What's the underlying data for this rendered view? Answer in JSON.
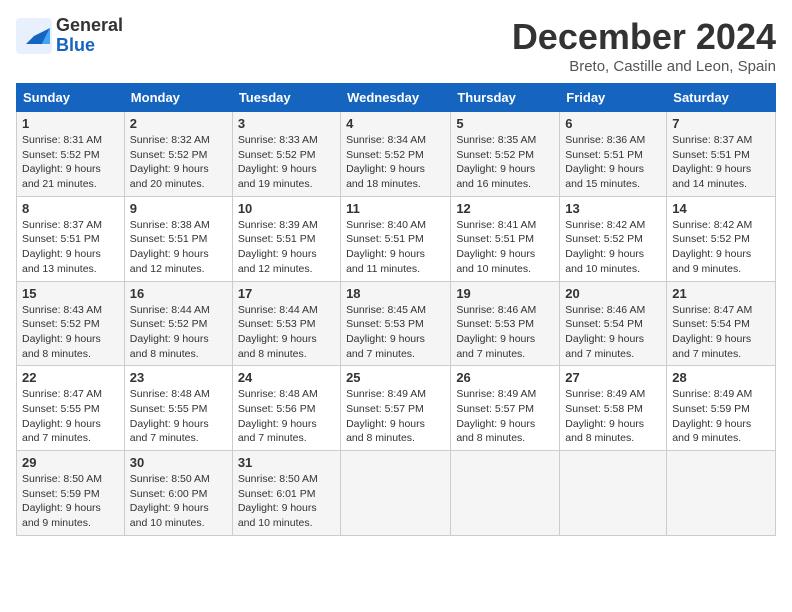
{
  "logo": {
    "line1": "General",
    "line2": "Blue"
  },
  "title": "December 2024",
  "subtitle": "Breto, Castille and Leon, Spain",
  "days_of_week": [
    "Sunday",
    "Monday",
    "Tuesday",
    "Wednesday",
    "Thursday",
    "Friday",
    "Saturday"
  ],
  "weeks": [
    [
      {
        "day": "1",
        "info": "Sunrise: 8:31 AM\nSunset: 5:52 PM\nDaylight: 9 hours\nand 21 minutes."
      },
      {
        "day": "2",
        "info": "Sunrise: 8:32 AM\nSunset: 5:52 PM\nDaylight: 9 hours\nand 20 minutes."
      },
      {
        "day": "3",
        "info": "Sunrise: 8:33 AM\nSunset: 5:52 PM\nDaylight: 9 hours\nand 19 minutes."
      },
      {
        "day": "4",
        "info": "Sunrise: 8:34 AM\nSunset: 5:52 PM\nDaylight: 9 hours\nand 18 minutes."
      },
      {
        "day": "5",
        "info": "Sunrise: 8:35 AM\nSunset: 5:52 PM\nDaylight: 9 hours\nand 16 minutes."
      },
      {
        "day": "6",
        "info": "Sunrise: 8:36 AM\nSunset: 5:51 PM\nDaylight: 9 hours\nand 15 minutes."
      },
      {
        "day": "7",
        "info": "Sunrise: 8:37 AM\nSunset: 5:51 PM\nDaylight: 9 hours\nand 14 minutes."
      }
    ],
    [
      {
        "day": "8",
        "info": "Sunrise: 8:37 AM\nSunset: 5:51 PM\nDaylight: 9 hours\nand 13 minutes."
      },
      {
        "day": "9",
        "info": "Sunrise: 8:38 AM\nSunset: 5:51 PM\nDaylight: 9 hours\nand 12 minutes."
      },
      {
        "day": "10",
        "info": "Sunrise: 8:39 AM\nSunset: 5:51 PM\nDaylight: 9 hours\nand 12 minutes."
      },
      {
        "day": "11",
        "info": "Sunrise: 8:40 AM\nSunset: 5:51 PM\nDaylight: 9 hours\nand 11 minutes."
      },
      {
        "day": "12",
        "info": "Sunrise: 8:41 AM\nSunset: 5:51 PM\nDaylight: 9 hours\nand 10 minutes."
      },
      {
        "day": "13",
        "info": "Sunrise: 8:42 AM\nSunset: 5:52 PM\nDaylight: 9 hours\nand 10 minutes."
      },
      {
        "day": "14",
        "info": "Sunrise: 8:42 AM\nSunset: 5:52 PM\nDaylight: 9 hours\nand 9 minutes."
      }
    ],
    [
      {
        "day": "15",
        "info": "Sunrise: 8:43 AM\nSunset: 5:52 PM\nDaylight: 9 hours\nand 8 minutes."
      },
      {
        "day": "16",
        "info": "Sunrise: 8:44 AM\nSunset: 5:52 PM\nDaylight: 9 hours\nand 8 minutes."
      },
      {
        "day": "17",
        "info": "Sunrise: 8:44 AM\nSunset: 5:53 PM\nDaylight: 9 hours\nand 8 minutes."
      },
      {
        "day": "18",
        "info": "Sunrise: 8:45 AM\nSunset: 5:53 PM\nDaylight: 9 hours\nand 7 minutes."
      },
      {
        "day": "19",
        "info": "Sunrise: 8:46 AM\nSunset: 5:53 PM\nDaylight: 9 hours\nand 7 minutes."
      },
      {
        "day": "20",
        "info": "Sunrise: 8:46 AM\nSunset: 5:54 PM\nDaylight: 9 hours\nand 7 minutes."
      },
      {
        "day": "21",
        "info": "Sunrise: 8:47 AM\nSunset: 5:54 PM\nDaylight: 9 hours\nand 7 minutes."
      }
    ],
    [
      {
        "day": "22",
        "info": "Sunrise: 8:47 AM\nSunset: 5:55 PM\nDaylight: 9 hours\nand 7 minutes."
      },
      {
        "day": "23",
        "info": "Sunrise: 8:48 AM\nSunset: 5:55 PM\nDaylight: 9 hours\nand 7 minutes."
      },
      {
        "day": "24",
        "info": "Sunrise: 8:48 AM\nSunset: 5:56 PM\nDaylight: 9 hours\nand 7 minutes."
      },
      {
        "day": "25",
        "info": "Sunrise: 8:49 AM\nSunset: 5:57 PM\nDaylight: 9 hours\nand 8 minutes."
      },
      {
        "day": "26",
        "info": "Sunrise: 8:49 AM\nSunset: 5:57 PM\nDaylight: 9 hours\nand 8 minutes."
      },
      {
        "day": "27",
        "info": "Sunrise: 8:49 AM\nSunset: 5:58 PM\nDaylight: 9 hours\nand 8 minutes."
      },
      {
        "day": "28",
        "info": "Sunrise: 8:49 AM\nSunset: 5:59 PM\nDaylight: 9 hours\nand 9 minutes."
      }
    ],
    [
      {
        "day": "29",
        "info": "Sunrise: 8:50 AM\nSunset: 5:59 PM\nDaylight: 9 hours\nand 9 minutes."
      },
      {
        "day": "30",
        "info": "Sunrise: 8:50 AM\nSunset: 6:00 PM\nDaylight: 9 hours\nand 10 minutes."
      },
      {
        "day": "31",
        "info": "Sunrise: 8:50 AM\nSunset: 6:01 PM\nDaylight: 9 hours\nand 10 minutes."
      },
      null,
      null,
      null,
      null
    ]
  ]
}
